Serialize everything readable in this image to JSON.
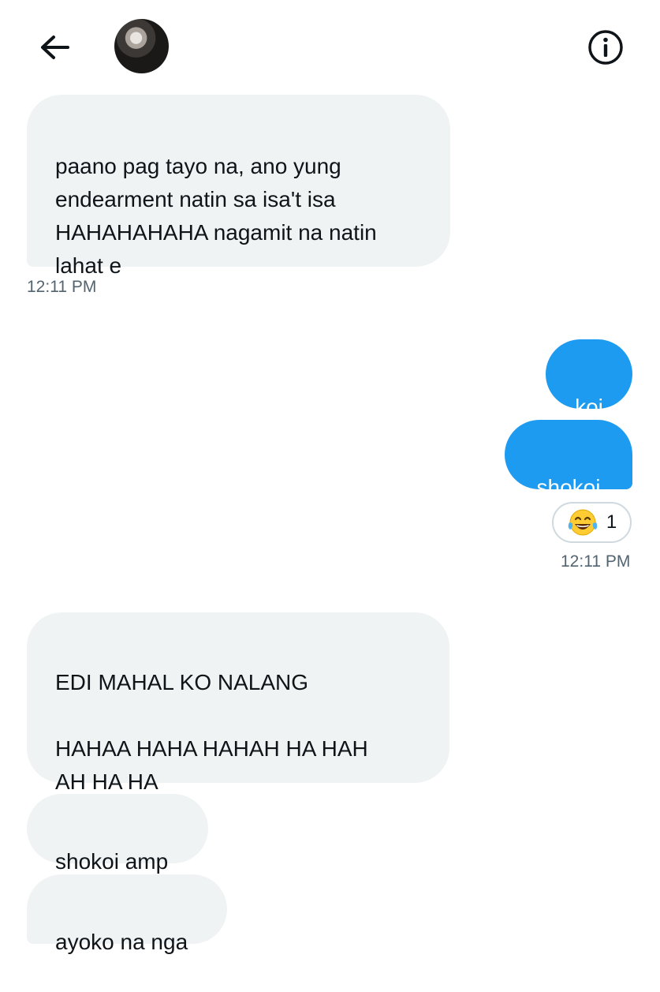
{
  "header": {
    "back_icon": "arrow-left-icon",
    "avatar_icon": "profile-avatar",
    "info_icon": "info-icon"
  },
  "messages": [
    {
      "dir": "in",
      "text": "paano pag tayo na, ano yung\nendearment natin sa isa't isa\nHAHAHAHAHA nagamit na natin\nlahat e"
    },
    {
      "dir": "out",
      "text": "koi"
    },
    {
      "dir": "out",
      "text": "shokoi"
    },
    {
      "dir": "in",
      "text": "EDI MAHAL KO NALANG\n\nHAHAA HAHA HAHAH  HA HAH\nAH HA HA"
    },
    {
      "dir": "in",
      "text": "shokoi amp"
    },
    {
      "dir": "in",
      "text": "ayoko na nga"
    }
  ],
  "timestamps": {
    "first": "12:11 PM",
    "second": "12:11 PM"
  },
  "reaction": {
    "emoji_icon": "face-with-tears-of-joy-icon",
    "count": "1"
  },
  "colors": {
    "incoming_bubble": "#eff3f4",
    "outgoing_bubble": "#1d9bf0",
    "timestamp": "#536471"
  }
}
